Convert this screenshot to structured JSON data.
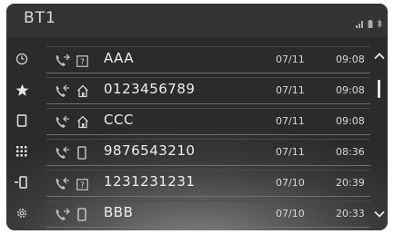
{
  "header": {
    "title": "BT1"
  },
  "status": {
    "signal_icon": "signal-bars-icon",
    "battery_icon": "battery-icon",
    "bluetooth_icon": "bluetooth-icon"
  },
  "sidebar": {
    "items": [
      {
        "name": "history",
        "icon": "clock-icon"
      },
      {
        "name": "favorites",
        "icon": "star-icon"
      },
      {
        "name": "contacts",
        "icon": "phone-book-icon"
      },
      {
        "name": "keypad",
        "icon": "keypad-icon"
      },
      {
        "name": "send-to-phone",
        "icon": "phone-transfer-icon"
      },
      {
        "name": "settings",
        "icon": "gear-icon"
      }
    ]
  },
  "calls": [
    {
      "direction": "outgoing",
      "type": "unknown",
      "name": "AAA",
      "date": "07/11",
      "time": "09:08"
    },
    {
      "direction": "incoming",
      "type": "home",
      "name": "0123456789",
      "date": "07/11",
      "time": "09:08"
    },
    {
      "direction": "incoming",
      "type": "home",
      "name": "CCC",
      "date": "07/11",
      "time": "09:08"
    },
    {
      "direction": "incoming",
      "type": "mobile",
      "name": "9876543210",
      "date": "07/11",
      "time": "08:36"
    },
    {
      "direction": "incoming",
      "type": "unknown",
      "name": "1231231231",
      "date": "07/10",
      "time": "20:39"
    },
    {
      "direction": "outgoing",
      "type": "mobile",
      "name": "BBB",
      "date": "07/10",
      "time": "20:33"
    }
  ],
  "colors": {
    "text": "#eeeeee",
    "background": "#3a3a3a",
    "header": "#333333"
  }
}
